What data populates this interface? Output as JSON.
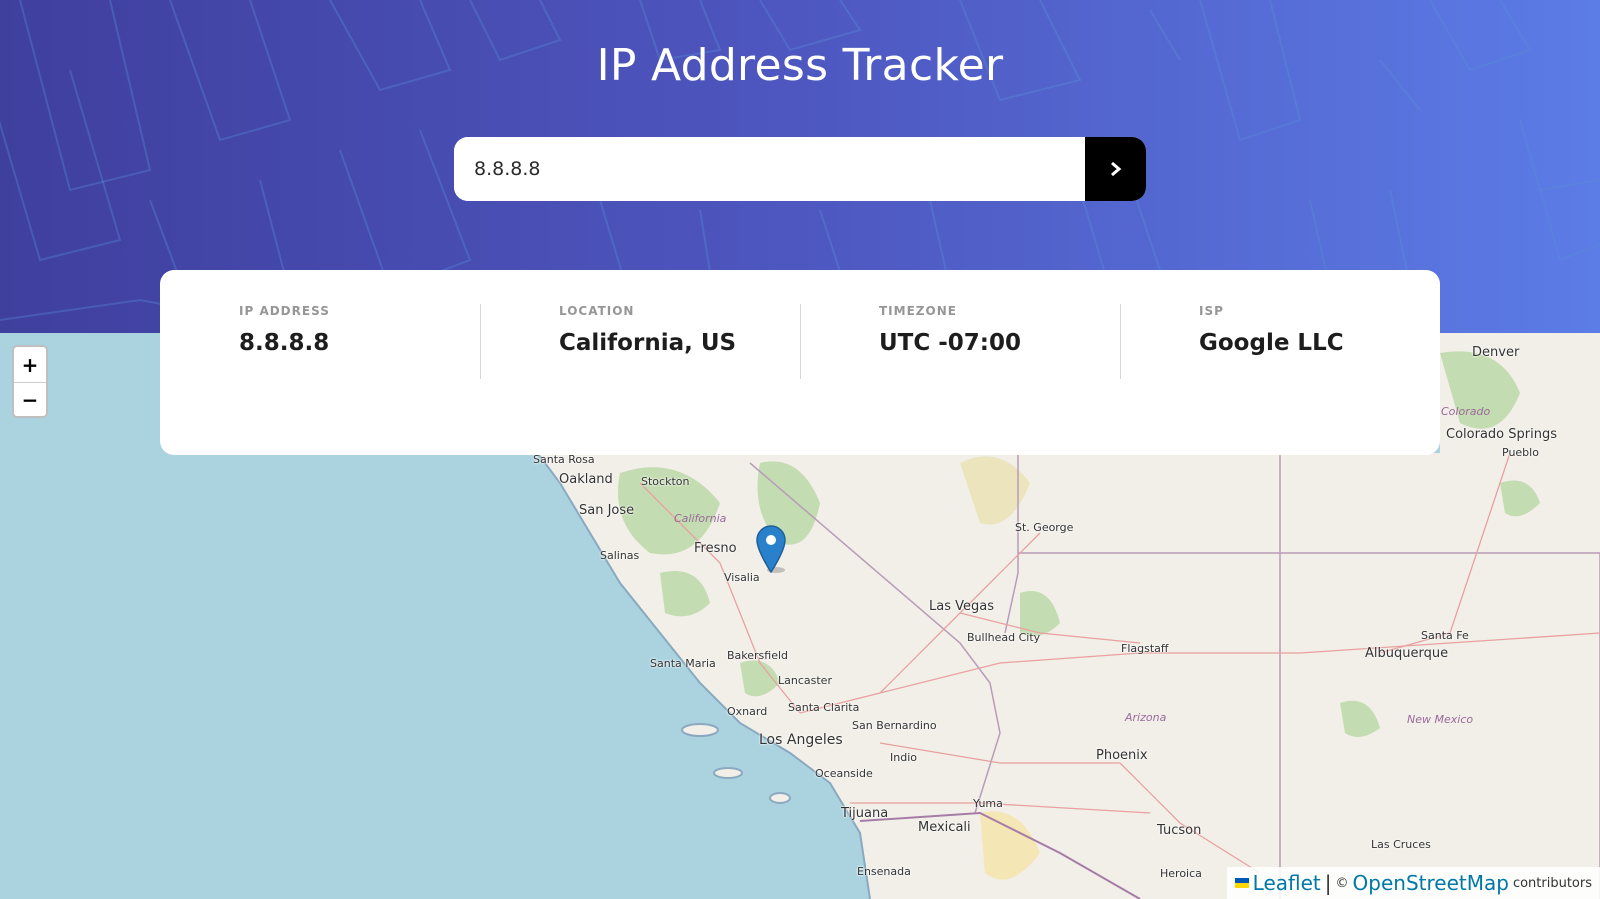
{
  "header": {
    "title": "IP Address Tracker"
  },
  "search": {
    "value": "8.8.8.8",
    "submit_icon": "chevron-right-icon"
  },
  "info": [
    {
      "label": "IP ADDRESS",
      "value": "8.8.8.8"
    },
    {
      "label": "LOCATION",
      "value": "California, US"
    },
    {
      "label": "TIMEZONE",
      "value": "UTC -07:00"
    },
    {
      "label": "ISP",
      "value": "Google LLC"
    }
  ],
  "map": {
    "zoom_in": "+",
    "zoom_out": "−",
    "marker_icon": "map-pin-icon",
    "cities": {
      "denver": "Denver",
      "colorado_springs": "Colorado Springs",
      "pueblo": "Pueblo",
      "santa_rosa": "Santa Rosa",
      "oakland": "Oakland",
      "stockton": "Stockton",
      "san_jose": "San Jose",
      "fresno": "Fresno",
      "salinas": "Salinas",
      "visalia": "Visalia",
      "st_george": "St. George",
      "las_vegas": "Las Vegas",
      "bullhead_city": "Bullhead City",
      "flagstaff": "Flagstaff",
      "santa_fe": "Santa Fe",
      "albuquerque": "Albuquerque",
      "santa_maria": "Santa Maria",
      "bakersfield": "Bakersfield",
      "lancaster": "Lancaster",
      "oxnard": "Oxnard",
      "santa_clarita": "Santa Clarita",
      "san_bernardino": "San Bernardino",
      "los_angeles": "Los Angeles",
      "oceanside": "Oceanside",
      "indio": "Indio",
      "phoenix": "Phoenix",
      "yuma": "Yuma",
      "tijuana": "Tijuana",
      "mexicali": "Mexicali",
      "tucson": "Tucson",
      "las_cruces": "Las Cruces",
      "ensenada": "Ensenada",
      "heroica": "Heroica"
    },
    "regions": {
      "california": "California",
      "colorado": "Colorado",
      "arizona": "Arizona",
      "new_mexico": "New Mexico"
    }
  },
  "attribution": {
    "leaflet": "Leaflet",
    "separator": "|",
    "copyright": "©",
    "osm": "OpenStreetMap",
    "contributors": "contributors",
    "flag_icon": "ukraine-flag-icon"
  }
}
